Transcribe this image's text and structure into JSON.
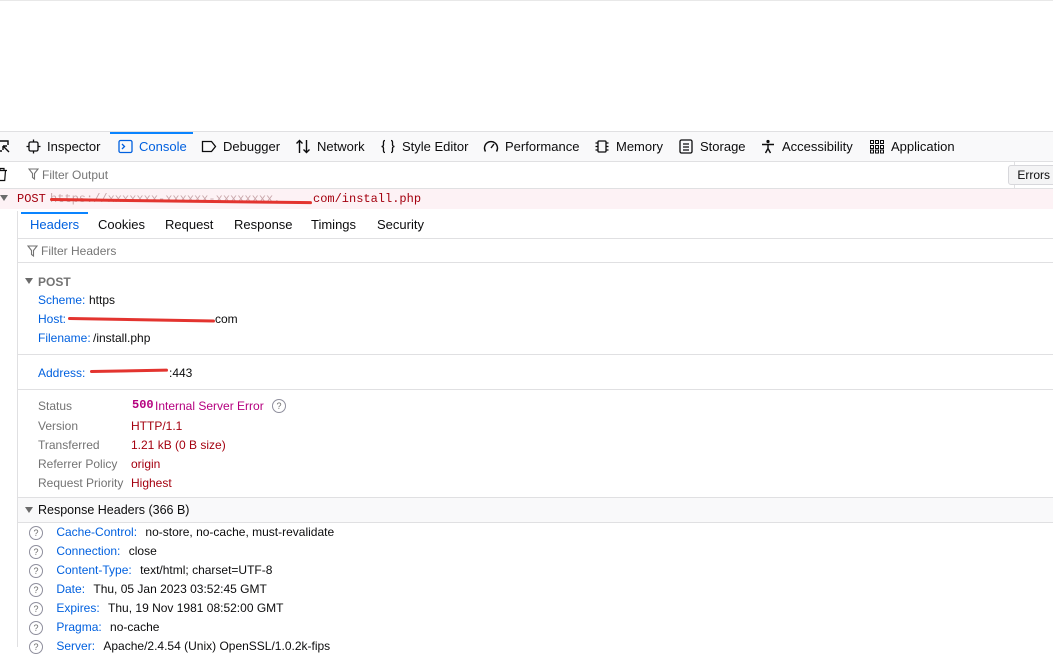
{
  "toolbar": {
    "tabs": [
      {
        "label": "Inspector",
        "icon": "inspector-icon"
      },
      {
        "label": "Console",
        "icon": "console-icon"
      },
      {
        "label": "Debugger",
        "icon": "debugger-icon"
      },
      {
        "label": "Network",
        "icon": "network-icon"
      },
      {
        "label": "Style Editor",
        "icon": "style-editor-icon"
      },
      {
        "label": "Performance",
        "icon": "performance-icon"
      },
      {
        "label": "Memory",
        "icon": "memory-icon"
      },
      {
        "label": "Storage",
        "icon": "storage-icon"
      },
      {
        "label": "Accessibility",
        "icon": "accessibility-icon"
      },
      {
        "label": "Application",
        "icon": "application-icon"
      }
    ],
    "active_tab": "Console",
    "accent_color": "#0a84ff"
  },
  "filter": {
    "placeholder": "Filter Output",
    "errors_label": "Errors"
  },
  "request": {
    "method": "POST",
    "url_suffix": "com/install.php"
  },
  "details": {
    "tabs": [
      "Headers",
      "Cookies",
      "Request",
      "Response",
      "Timings",
      "Security"
    ],
    "active_tab": "Headers",
    "filter_placeholder": "Filter Headers",
    "section_label": "POST",
    "scheme_label": "Scheme:",
    "scheme_value": "https",
    "host_label": "Host:",
    "host_suffix": "com",
    "filename_label": "Filename:",
    "filename_value": "/install.php",
    "address_label": "Address:",
    "address_suffix": ":443",
    "status_label": "Status",
    "status_code": "500",
    "status_text": "Internal Server Error",
    "version_label": "Version",
    "version_value": "HTTP/1.1",
    "transferred_label": "Transferred",
    "transferred_value": "1.21 kB (0 B size)",
    "referrer_label": "Referrer Policy",
    "referrer_value": "origin",
    "priority_label": "Request Priority",
    "priority_value": "Highest",
    "response_headers_label": "Response Headers (366 B)",
    "headers": [
      {
        "name": "Cache-Control:",
        "value": "no-store, no-cache, must-revalidate"
      },
      {
        "name": "Connection:",
        "value": "close"
      },
      {
        "name": "Content-Type:",
        "value": "text/html; charset=UTF-8"
      },
      {
        "name": "Date:",
        "value": "Thu, 05 Jan 2023 03:52:45 GMT"
      },
      {
        "name": "Expires:",
        "value": "Thu, 19 Nov 1981 08:52:00 GMT"
      },
      {
        "name": "Pragma:",
        "value": "no-cache"
      },
      {
        "name": "Server:",
        "value": "Apache/2.4.54 (Unix) OpenSSL/1.0.2k-fips"
      }
    ]
  }
}
